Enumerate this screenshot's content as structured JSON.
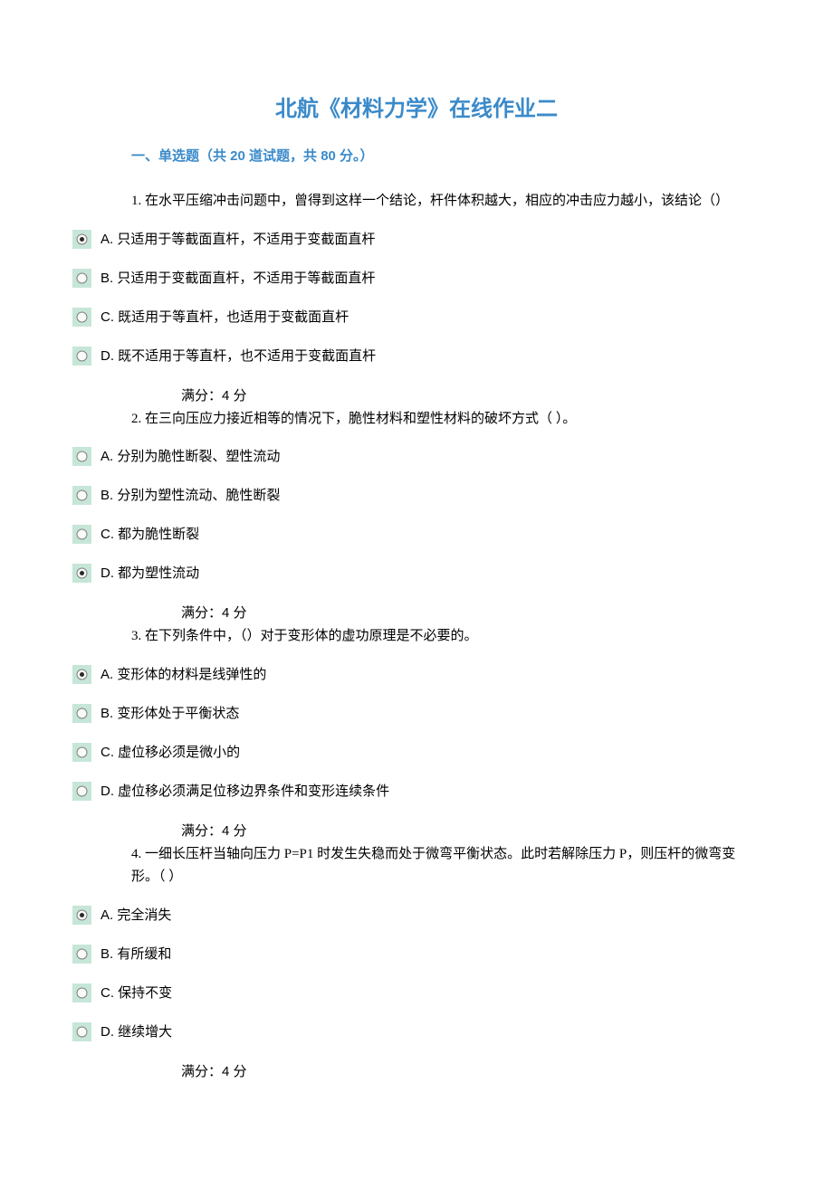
{
  "title": "北航《材料力学》在线作业二",
  "section_header": "一、单选题（共 20 道试题，共 80 分。）",
  "score_label": "满分：4  分",
  "questions": [
    {
      "stem": "1.  在水平压缩冲击问题中，曾得到这样一个结论，杆件体积越大，相应的冲击应力越小，该结论（）",
      "stem_indent": false,
      "options": [
        {
          "label": "A.  只适用于等截面直杆，不适用于变截面直杆",
          "selected": true
        },
        {
          "label": "B.  只适用于变截面直杆，不适用于等截面直杆",
          "selected": false
        },
        {
          "label": "C.  既适用于等直杆，也适用于变截面直杆",
          "selected": false
        },
        {
          "label": "D.  既不适用于等直杆，也不适用于变截面直杆",
          "selected": false
        }
      ]
    },
    {
      "stem": "2.  在三向压应力接近相等的情况下，脆性材料和塑性材料的破坏方式（  ）。",
      "stem_indent": true,
      "options": [
        {
          "label": "A.  分别为脆性断裂、塑性流动",
          "selected": false
        },
        {
          "label": "B.  分别为塑性流动、脆性断裂",
          "selected": false
        },
        {
          "label": "C.  都为脆性断裂",
          "selected": false
        },
        {
          "label": "D.  都为塑性流动",
          "selected": true
        }
      ]
    },
    {
      "stem": "3.  在下列条件中，（）对于变形体的虚功原理是不必要的。",
      "stem_indent": true,
      "options": [
        {
          "label": "A.  变形体的材料是线弹性的",
          "selected": true
        },
        {
          "label": "B.  变形体处于平衡状态",
          "selected": false
        },
        {
          "label": "C.  虚位移必须是微小的",
          "selected": false
        },
        {
          "label": "D.  虚位移必须满足位移边界条件和变形连续条件",
          "selected": false
        }
      ]
    },
    {
      "stem": "4.  一细长压杆当轴向压力 P=P1 时发生失稳而处于微弯平衡状态。此时若解除压力 P，则压杆的微弯变形。（  ）",
      "stem_indent": true,
      "options": [
        {
          "label": "A.  完全消失",
          "selected": true
        },
        {
          "label": "B.  有所缓和",
          "selected": false
        },
        {
          "label": "C.  保持不变",
          "selected": false
        },
        {
          "label": "D.  继续增大",
          "selected": false
        }
      ]
    }
  ]
}
